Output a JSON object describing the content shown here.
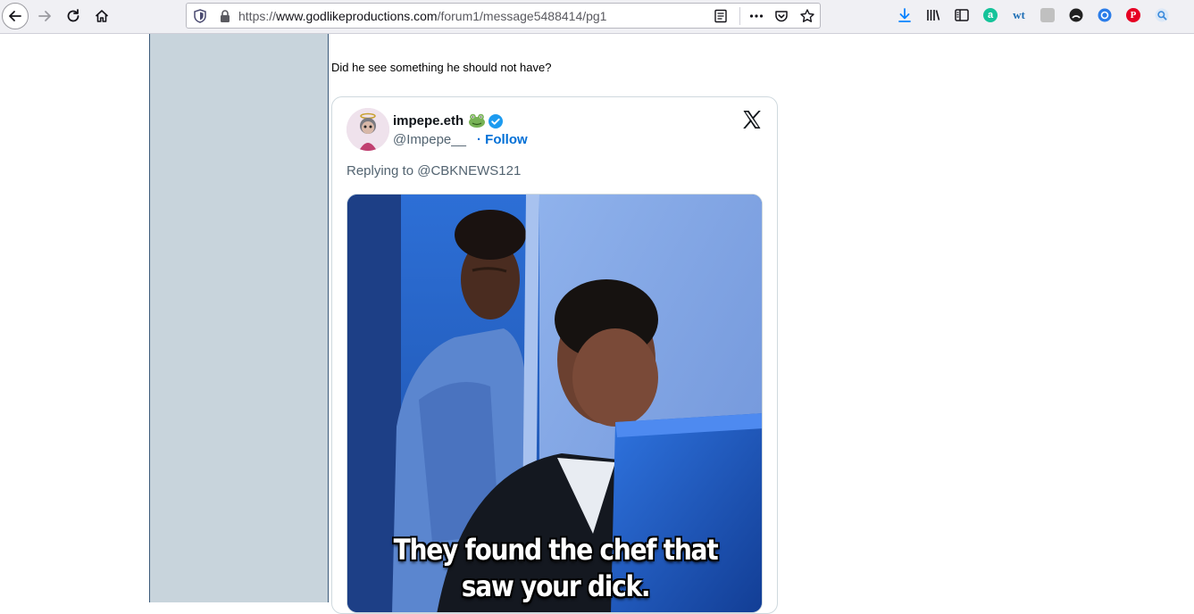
{
  "browser": {
    "url": {
      "scheme": "https://",
      "host": "www.godlikeproductions.com",
      "path": "/forum1/message5488414/pg1"
    },
    "icons": {
      "back": "back-arrow-icon",
      "forward": "forward-arrow-icon",
      "reload": "reload-icon",
      "home": "home-icon",
      "tracking": "tracking-shield-icon",
      "lock": "lock-icon",
      "reader": "reader-view-icon",
      "more": "more-actions-icon",
      "pocket": "pocket-icon",
      "bookmark": "bookmark-star-icon",
      "download": "download-icon",
      "library": "library-icon",
      "sidebar": "sidebar-icon"
    },
    "extensions": [
      {
        "name": "grammarly-icon",
        "glyph": "a",
        "color": "#15c39a"
      },
      {
        "name": "wt-icon",
        "glyph": "wt",
        "color": "#1f6fb5"
      },
      {
        "name": "puzzle-extension-icon",
        "glyph": "",
        "color": "#b8b8b8"
      },
      {
        "name": "dark-reader-icon",
        "glyph": "",
        "color": "#222222"
      },
      {
        "name": "vpn-extension-icon",
        "glyph": "",
        "color": "#2b7de9"
      },
      {
        "name": "pinterest-icon",
        "glyph": "P",
        "color": "#e60023"
      },
      {
        "name": "search-extension-icon",
        "glyph": "",
        "color": "#3c8bdc"
      }
    ]
  },
  "post": {
    "text": "Did he see something he should not have?"
  },
  "tweet": {
    "display_name": "impepe.eth",
    "handle": "@Impepe__",
    "follow_label": "· Follow",
    "replying_to": "Replying to @CBKNEWS121",
    "image_caption": "They found the chef that saw your dick.",
    "icons": {
      "avatar": "avatar",
      "frog": "frog-emoji-icon",
      "verified": "verified-badge-icon",
      "logo": "x-logo-icon"
    },
    "colors": {
      "follow": "#006fd6",
      "verified": "#1d9bf0"
    }
  }
}
